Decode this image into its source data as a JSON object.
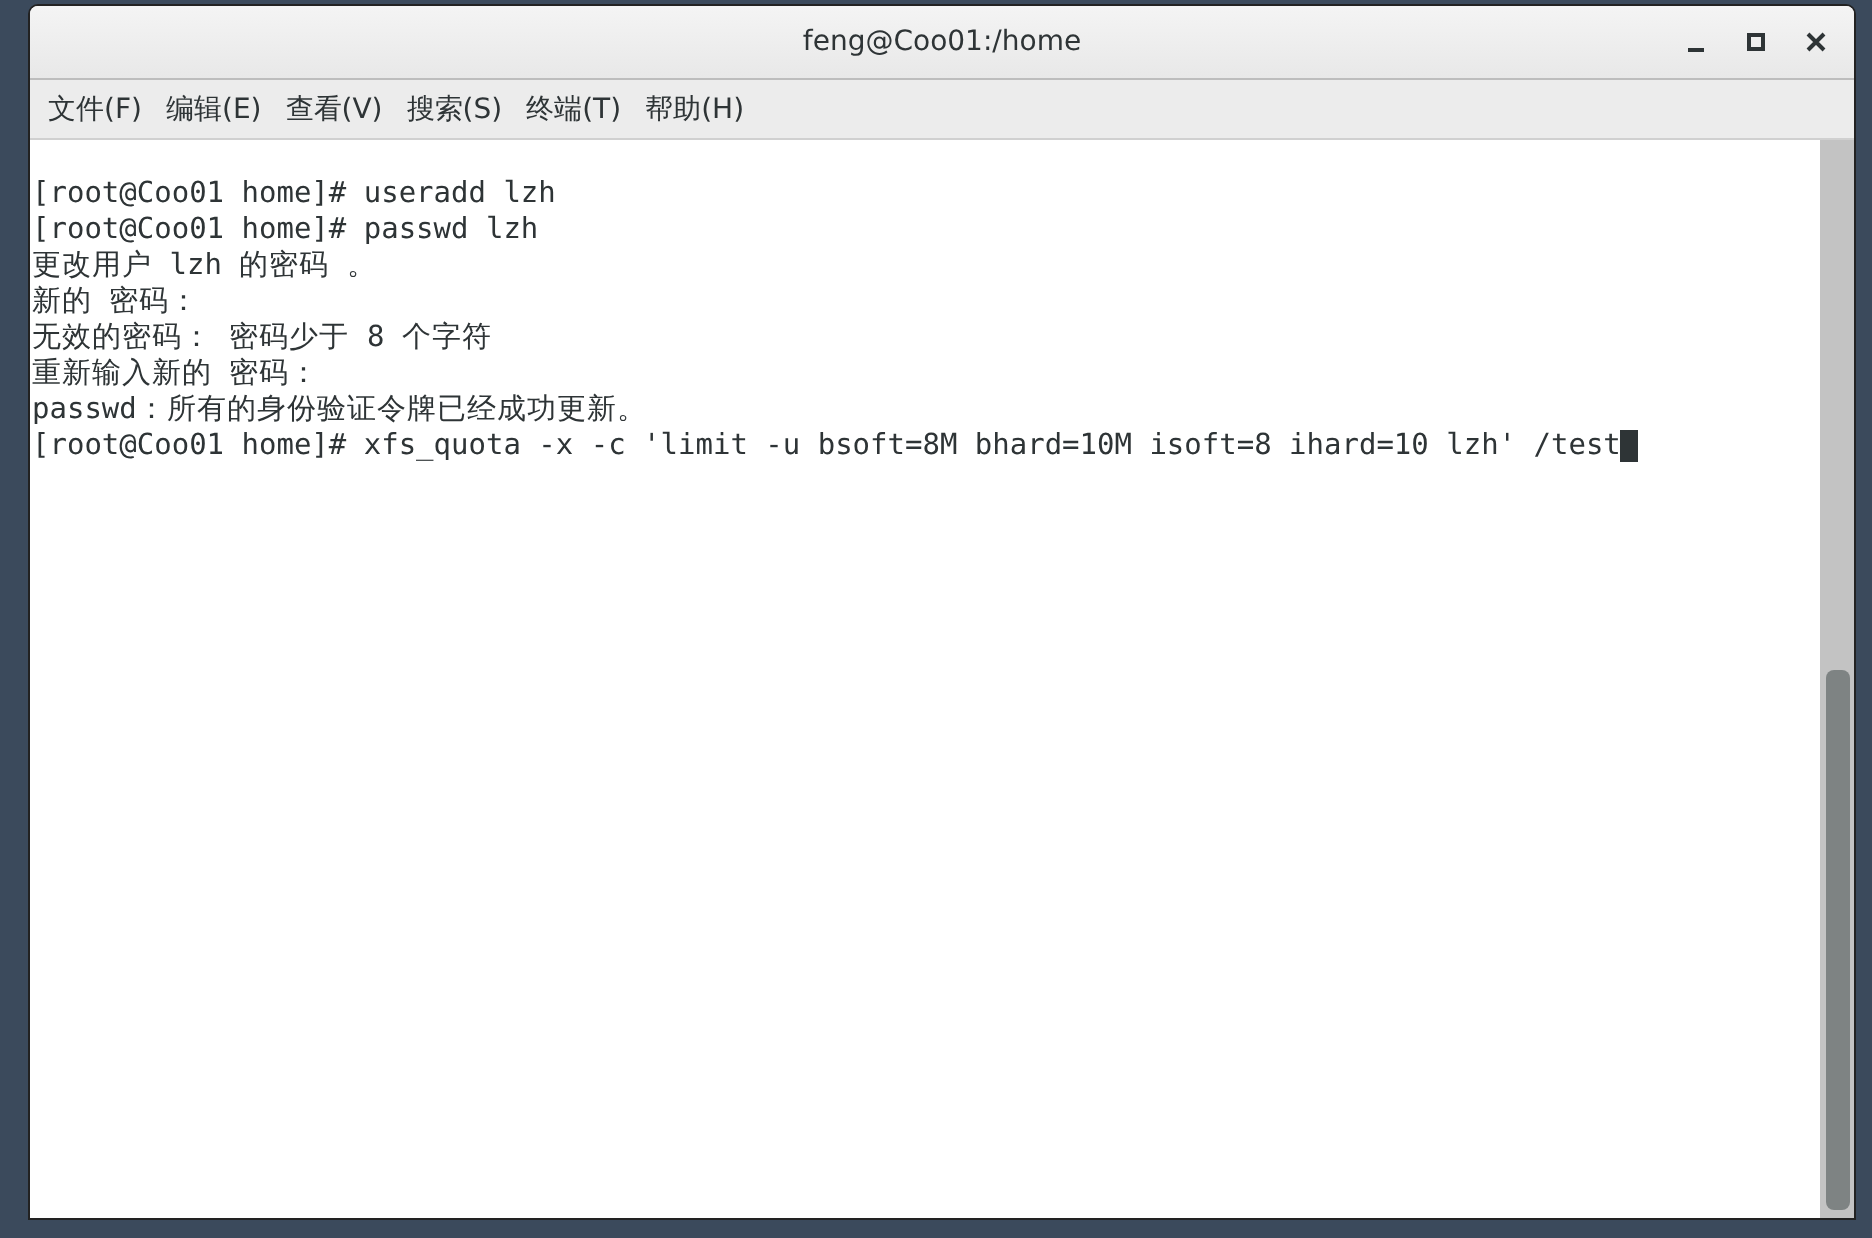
{
  "window": {
    "title": "feng@Coo01:/home"
  },
  "menu": [
    "文件(F)",
    "编辑(E)",
    "查看(V)",
    "搜索(S)",
    "终端(T)",
    "帮助(H)"
  ],
  "terminal": {
    "lines": [
      {
        "text": "[root@Coo01 home]# useradd lzh",
        "cursor": false
      },
      {
        "text": "[root@Coo01 home]# passwd lzh",
        "cursor": false
      },
      {
        "text": "更改用户 lzh 的密码 。",
        "cursor": false
      },
      {
        "text": "新的 密码：",
        "cursor": false
      },
      {
        "text": "无效的密码： 密码少于 8 个字符",
        "cursor": false
      },
      {
        "text": "重新输入新的 密码：",
        "cursor": false
      },
      {
        "text": "passwd：所有的身份验证令牌已经成功更新。",
        "cursor": false
      },
      {
        "text": "[root@Coo01 home]# xfs_quota -x -c 'limit -u bsoft=8M bhard=10M isoft=8 ihard=10 lzh' /test",
        "cursor": true
      }
    ]
  }
}
